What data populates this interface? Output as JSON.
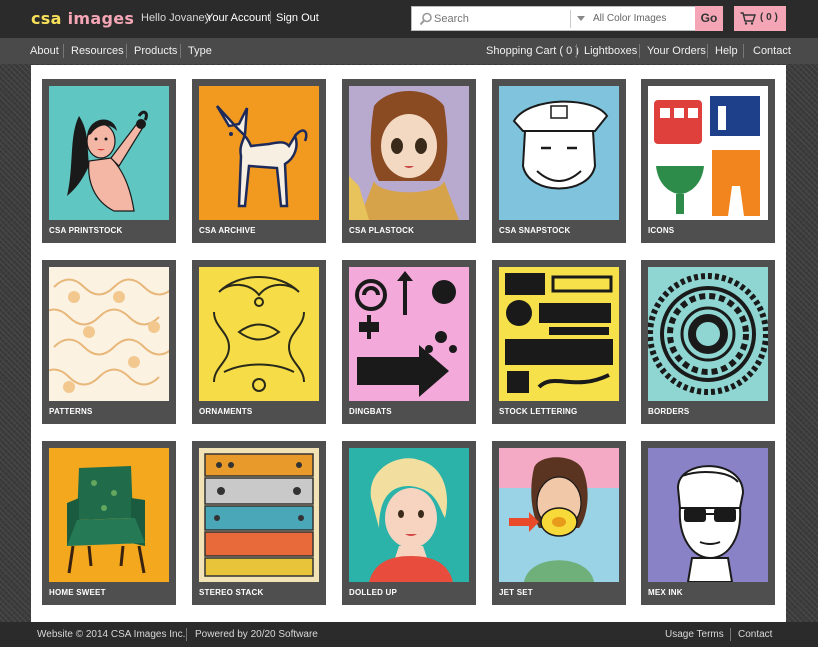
{
  "header": {
    "logo_main": "csa",
    "logo_accent": "images",
    "greeting": "Hello Jovaney",
    "account_link": "Your Account",
    "signout_link": "Sign Out",
    "search_placeholder": "Search",
    "search_filter": "All Color Images",
    "go_label": "Go",
    "cart_count": "( 0 )"
  },
  "nav": {
    "left": [
      "About",
      "Resources",
      "Products",
      "Type"
    ],
    "right": [
      "Shopping Cart ( 0 )",
      "Lightboxes",
      "Your Orders",
      "Help",
      "Contact"
    ]
  },
  "tiles": [
    {
      "label": "CSA PRINTSTOCK",
      "bg": "#5fc6c2"
    },
    {
      "label": "CSA ARCHIVE",
      "bg": "#f29a1f"
    },
    {
      "label": "CSA PLASTOCK",
      "bg": "#b8a9cf"
    },
    {
      "label": "CSA SNAPSTOCK",
      "bg": "#7fc3dc"
    },
    {
      "label": "ICONS",
      "bg": "#ffffff"
    },
    {
      "label": "PATTERNS",
      "bg": "#fbf2e2"
    },
    {
      "label": "ORNAMENTS",
      "bg": "#f6dc46"
    },
    {
      "label": "DINGBATS",
      "bg": "#f3a9d9"
    },
    {
      "label": "STOCK LETTERING",
      "bg": "#f6e14a"
    },
    {
      "label": "BORDERS",
      "bg": "#8fd6d2"
    },
    {
      "label": "HOME SWEET",
      "bg": "#f3a81e"
    },
    {
      "label": "STEREO STACK",
      "bg": "#f2e3b6"
    },
    {
      "label": "DOLLED UP",
      "bg": "#2bb3a9"
    },
    {
      "label": "JET SET",
      "bg": "#f4a9c4"
    },
    {
      "label": "MEX INK",
      "bg": "#8a82c7"
    }
  ],
  "footer": {
    "copyright": "Website © 2014 CSA Images Inc.",
    "powered": "Powered by 20/20 Software",
    "usage": "Usage Terms",
    "contact": "Contact"
  },
  "colors": {
    "accent_pink": "#f4a6b6",
    "logo_yellow": "#f7e15a",
    "header_bg": "#2b2b2b",
    "nav_bg": "#4a4a4a",
    "tile_frame": "#4f4f4f"
  },
  "icons": [
    "search-icon",
    "chevron-down-icon",
    "cart-icon"
  ]
}
